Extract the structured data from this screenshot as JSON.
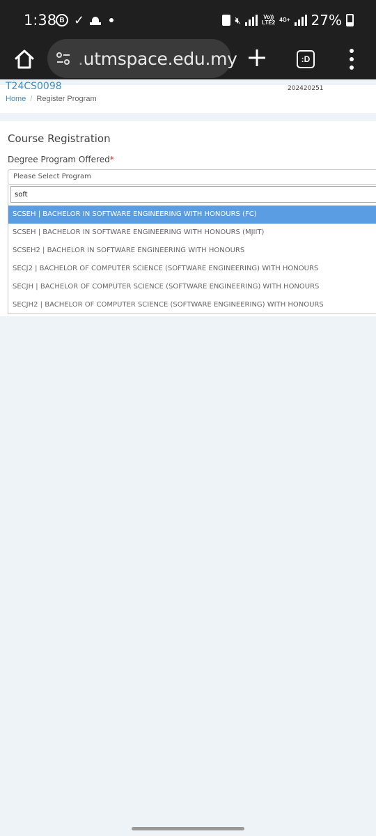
{
  "status_bar": {
    "time": "1:38",
    "battery_pct": "27%",
    "network_4g": "4G+",
    "volte_top": "Vo))",
    "volte_bottom": "LTE2",
    "notif_b": "B",
    "icons": [
      "b-circle-icon",
      "check-icon",
      "mosque-icon",
      "dot-icon",
      "battery-saver-icon",
      "mute-icon",
      "signal-icon",
      "volte-icon",
      "4g-icon",
      "signal-icon",
      "battery-icon"
    ]
  },
  "browser": {
    "url_prefix": ".",
    "url_text": "utmspace.edu.my",
    "tabs_label": ":D"
  },
  "header": {
    "matric_partial": "T24CS0098",
    "session": "202420251",
    "breadcrumb": {
      "home": "Home",
      "separator": "/",
      "current": "Register Program"
    }
  },
  "registration": {
    "title": "Course Registration",
    "field_label": "Degree Program Offered",
    "required_mark": "*",
    "select_placeholder": "Please Select Program",
    "search_value": "soft",
    "options": [
      {
        "label": "SCSEH | BACHELOR IN SOFTWARE ENGINEERING WITH HONOURS (FC)",
        "highlighted": true
      },
      {
        "label": "SCSEH | BACHELOR IN SOFTWARE ENGINEERING WITH HONOURS (MJIIT)",
        "highlighted": false
      },
      {
        "label": "SCSEH2 | BACHELOR IN SOFTWARE ENGINEERING WITH HONOURS",
        "highlighted": false
      },
      {
        "label": "SECJ2 | BACHELOR OF COMPUTER SCIENCE (SOFTWARE ENGINEERING) WITH HONOURS",
        "highlighted": false
      },
      {
        "label": "SECJH | BACHELOR OF COMPUTER SCIENCE (SOFTWARE ENGINEERING) WITH HONOURS",
        "highlighted": false
      },
      {
        "label": "SECJH2 | BACHELOR OF COMPUTER SCIENCE (SOFTWARE ENGINEERING) WITH HONOURS",
        "highlighted": false
      }
    ]
  },
  "colors": {
    "highlight": "#5a9de3",
    "link": "#3b8ec9",
    "required": "#d9342b",
    "page_bg": "#edf3f7"
  }
}
